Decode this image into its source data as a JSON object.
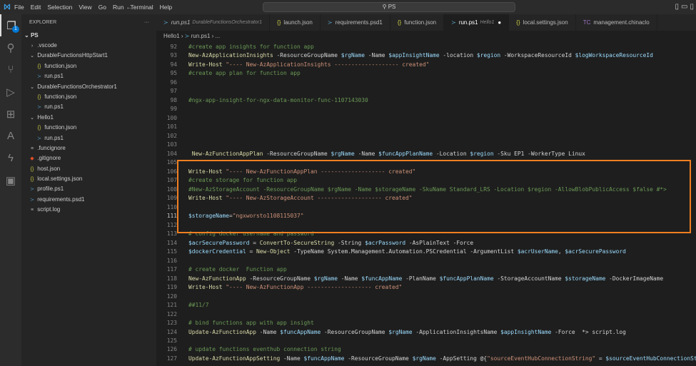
{
  "titlebar": {
    "menu": [
      "File",
      "Edit",
      "Selection",
      "View",
      "Go",
      "Run",
      "Terminal",
      "Help"
    ],
    "search": "PS",
    "back_icon": "arrow-left",
    "forward_icon": "arrow-right"
  },
  "activity": {
    "badge": "1",
    "icons": [
      "files-icon",
      "search-icon",
      "source-control-icon",
      "run-debug-icon",
      "extensions-icon",
      "azure-icon",
      "azure-functions-icon",
      "remote-explorer-icon"
    ]
  },
  "sidebar": {
    "title": "EXPLORER",
    "more": "···",
    "root": "PS",
    "items": [
      {
        "label": ".vscode",
        "type": "folder-closed",
        "depth": 1
      },
      {
        "label": "DurableFunctionsHttpStart1",
        "type": "folder-open",
        "depth": 1
      },
      {
        "label": "function.json",
        "type": "json",
        "depth": 2
      },
      {
        "label": "run.ps1",
        "type": "ps",
        "depth": 2
      },
      {
        "label": "DurableFunctionsOrchestrator1",
        "type": "folder-open",
        "depth": 1
      },
      {
        "label": "function.json",
        "type": "json",
        "depth": 2
      },
      {
        "label": "run.ps1",
        "type": "ps",
        "depth": 2
      },
      {
        "label": "Hello1",
        "type": "folder-open",
        "depth": 1
      },
      {
        "label": "function.json",
        "type": "json",
        "depth": 2
      },
      {
        "label": "run.ps1",
        "type": "ps",
        "depth": 2
      },
      {
        "label": ".funcignore",
        "type": "text",
        "depth": 1
      },
      {
        "label": ".gitignore",
        "type": "git",
        "depth": 1
      },
      {
        "label": "host.json",
        "type": "json",
        "depth": 1
      },
      {
        "label": "local.settings.json",
        "type": "json",
        "depth": 1
      },
      {
        "label": "profile.ps1",
        "type": "ps",
        "depth": 1
      },
      {
        "label": "requirements.psd1",
        "type": "ps",
        "depth": 1
      },
      {
        "label": "script.log",
        "type": "text",
        "depth": 1
      }
    ]
  },
  "tabs": [
    {
      "label": "run.ps1",
      "sub": "DurableFunctionsOrchestrator1",
      "icon": "ps",
      "italic": true
    },
    {
      "label": "launch.json",
      "icon": "json"
    },
    {
      "label": "requirements.psd1",
      "icon": "ps"
    },
    {
      "label": "function.json",
      "icon": "json"
    },
    {
      "label": "run.ps1",
      "sub": "Hello1",
      "icon": "ps",
      "active": true,
      "modified": true
    },
    {
      "label": "local.settings.json",
      "icon": "json"
    },
    {
      "label": "management.chinaclo",
      "icon": "tc"
    }
  ],
  "breadcrumb": [
    "Hello1",
    "run.ps1",
    "..."
  ],
  "editor": {
    "current_line": "111",
    "lines": [
      {
        "n": "92",
        "t": [
          [
            "comment",
            "#create app insights for function app"
          ]
        ]
      },
      {
        "n": "93",
        "t": [
          [
            "command",
            "New-AzApplicationInsights"
          ],
          [
            "param",
            " -ResourceGroupName "
          ],
          [
            "variable",
            "$rgName"
          ],
          [
            "param",
            " -Name "
          ],
          [
            "variable",
            "$appInsightName"
          ],
          [
            "param",
            " -location "
          ],
          [
            "variable",
            "$region"
          ],
          [
            "param",
            " -WorkspaceResourceId "
          ],
          [
            "variable",
            "$logWorkspaceResourceId"
          ]
        ]
      },
      {
        "n": "94",
        "t": [
          [
            "command",
            "Write-Host"
          ],
          [
            "plain",
            " "
          ],
          [
            "string",
            "\"---- New-AzApplicationInsights ------------------- created\""
          ]
        ]
      },
      {
        "n": "95",
        "t": [
          [
            "comment",
            "#create app plan for function app"
          ]
        ]
      },
      {
        "n": "96",
        "t": []
      },
      {
        "n": "97",
        "t": []
      },
      {
        "n": "98",
        "t": [
          [
            "comment",
            "#ngx-app-insight-for-ngx-data-monitor-func-1107143030"
          ]
        ]
      },
      {
        "n": "99",
        "t": []
      },
      {
        "n": "100",
        "t": []
      },
      {
        "n": "101",
        "t": []
      },
      {
        "n": "102",
        "t": []
      },
      {
        "n": "103",
        "t": []
      },
      {
        "n": "104",
        "t": [
          [
            "plain",
            " "
          ],
          [
            "command",
            "New-AzFunctionAppPlan"
          ],
          [
            "param",
            " -ResourceGroupName "
          ],
          [
            "variable",
            "$rgName"
          ],
          [
            "param",
            " -Name "
          ],
          [
            "variable",
            "$funcAppPlanName"
          ],
          [
            "param",
            " -Location "
          ],
          [
            "variable",
            "$region"
          ],
          [
            "param",
            " -Sku EP1 -WorkerType Linux"
          ]
        ]
      },
      {
        "n": "105",
        "t": []
      },
      {
        "n": "106",
        "t": [
          [
            "command",
            "Write-Host"
          ],
          [
            "plain",
            " "
          ],
          [
            "string",
            "\"---- New-AzFunctionAppPlan ------------------- created\""
          ]
        ]
      },
      {
        "n": "107",
        "t": [
          [
            "comment",
            "#create storage for function app"
          ]
        ]
      },
      {
        "n": "108",
        "t": [
          [
            "comment",
            "#New-AzStorageAccount -ResourceGroupName $rgName -Name $storageName -SkuName Standard_LRS -Location $region -AllowBlobPublicAccess $false #*>"
          ]
        ]
      },
      {
        "n": "109",
        "t": [
          [
            "command",
            "Write-Host"
          ],
          [
            "plain",
            " "
          ],
          [
            "string",
            "\"---- New-AzStorageAccount ------------------- created\""
          ]
        ]
      },
      {
        "n": "110",
        "t": []
      },
      {
        "n": "111",
        "t": [
          [
            "variable",
            "$storageName"
          ],
          [
            "plain",
            "="
          ],
          [
            "string",
            "\"ngxworsto1108115037\""
          ]
        ]
      },
      {
        "n": "112",
        "t": []
      },
      {
        "n": "113",
        "t": [
          [
            "comment",
            "# config docker username and password"
          ]
        ]
      },
      {
        "n": "114",
        "t": [
          [
            "variable",
            "$acrSecurePassword"
          ],
          [
            "plain",
            " = "
          ],
          [
            "command",
            "ConvertTo-SecureString"
          ],
          [
            "param",
            " -String "
          ],
          [
            "variable",
            "$acrPassword"
          ],
          [
            "param",
            " -AsPlainText -Force"
          ]
        ]
      },
      {
        "n": "115",
        "t": [
          [
            "variable",
            "$dockerCredential"
          ],
          [
            "plain",
            " = "
          ],
          [
            "command",
            "New-Object"
          ],
          [
            "param",
            " -TypeName System.Management.Automation.PSCredential -ArgumentList "
          ],
          [
            "variable",
            "$acrUserName"
          ],
          [
            "plain",
            ", "
          ],
          [
            "variable",
            "$acrSecurePassword"
          ]
        ]
      },
      {
        "n": "116",
        "t": []
      },
      {
        "n": "117",
        "t": [
          [
            "comment",
            "# create docker  Function app"
          ]
        ]
      },
      {
        "n": "118",
        "t": [
          [
            "command",
            "New-AzFunctionApp"
          ],
          [
            "param",
            " -ResourceGroupName "
          ],
          [
            "variable",
            "$rgName"
          ],
          [
            "param",
            " -Name "
          ],
          [
            "variable",
            "$funcAppName"
          ],
          [
            "param",
            " -PlanName "
          ],
          [
            "variable",
            "$funcAppPlanName"
          ],
          [
            "param",
            " -StorageAccountName "
          ],
          [
            "variable",
            "$storageName"
          ],
          [
            "param",
            " -DockerImageName"
          ]
        ]
      },
      {
        "n": "119",
        "t": [
          [
            "command",
            "Write-Host"
          ],
          [
            "plain",
            " "
          ],
          [
            "string",
            "\"---- New-AzFunctionApp ------------------- created\""
          ]
        ]
      },
      {
        "n": "120",
        "t": []
      },
      {
        "n": "121",
        "t": [
          [
            "comment",
            "##11/7"
          ]
        ]
      },
      {
        "n": "122",
        "t": []
      },
      {
        "n": "123",
        "t": [
          [
            "comment",
            "# bind functions app with app insight"
          ]
        ]
      },
      {
        "n": "124",
        "t": [
          [
            "command",
            "Update-AzFunctionApp"
          ],
          [
            "param",
            " -Name "
          ],
          [
            "variable",
            "$funcAppName"
          ],
          [
            "param",
            " -ResourceGroupName "
          ],
          [
            "variable",
            "$rgName"
          ],
          [
            "param",
            " -ApplicationInsightsName "
          ],
          [
            "variable",
            "$appInsightName"
          ],
          [
            "param",
            " -Force  *> script.log"
          ]
        ]
      },
      {
        "n": "125",
        "t": []
      },
      {
        "n": "126",
        "t": [
          [
            "comment",
            "# update functions eventhub connection string"
          ]
        ]
      },
      {
        "n": "127",
        "t": [
          [
            "command",
            "Update-AzFunctionAppSetting"
          ],
          [
            "param",
            " -Name "
          ],
          [
            "variable",
            "$funcAppName"
          ],
          [
            "param",
            " -ResourceGroupName "
          ],
          [
            "variable",
            "$rgName"
          ],
          [
            "param",
            " -AppSetting @{"
          ],
          [
            "string",
            "\"sourceEventHubConnectionString\""
          ],
          [
            "plain",
            " = "
          ],
          [
            "variable",
            "$sourceEventHubConnectionString"
          ]
        ]
      }
    ]
  },
  "highlight_color": "#f07f21"
}
